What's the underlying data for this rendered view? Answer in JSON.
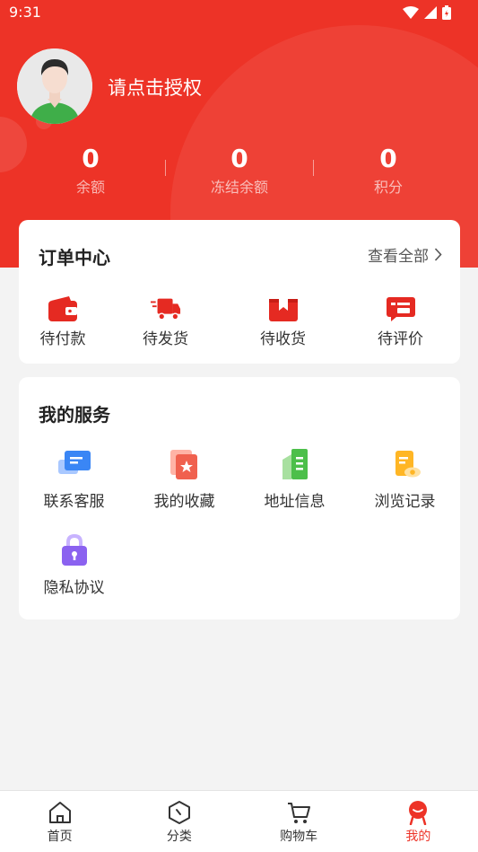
{
  "status_bar": {
    "time": "9:31"
  },
  "profile": {
    "login_prompt": "请点击授权"
  },
  "stats": [
    {
      "value": "0",
      "label": "余额"
    },
    {
      "value": "0",
      "label": "冻结余额"
    },
    {
      "value": "0",
      "label": "积分"
    }
  ],
  "orders": {
    "title": "订单中心",
    "view_all": "查看全部",
    "items": [
      {
        "label": "待付款",
        "icon": "wallet-icon"
      },
      {
        "label": "待发货",
        "icon": "delivery-truck-icon"
      },
      {
        "label": "待收货",
        "icon": "package-box-icon"
      },
      {
        "label": "待评价",
        "icon": "review-message-icon"
      }
    ]
  },
  "services": {
    "title": "我的服务",
    "items": [
      {
        "label": "联系客服",
        "icon": "chat-bubble-icon"
      },
      {
        "label": "我的收藏",
        "icon": "star-favorite-icon"
      },
      {
        "label": "地址信息",
        "icon": "address-book-icon"
      },
      {
        "label": "浏览记录",
        "icon": "history-eye-icon"
      },
      {
        "label": "隐私协议",
        "icon": "lock-icon"
      }
    ]
  },
  "tabbar": [
    {
      "label": "首页",
      "icon": "home-icon"
    },
    {
      "label": "分类",
      "icon": "category-icon"
    },
    {
      "label": "购物车",
      "icon": "cart-icon"
    },
    {
      "label": "我的",
      "icon": "profile-mascot-icon"
    }
  ],
  "colors": {
    "brand": "#ed3327",
    "background": "#f3f3f3"
  }
}
